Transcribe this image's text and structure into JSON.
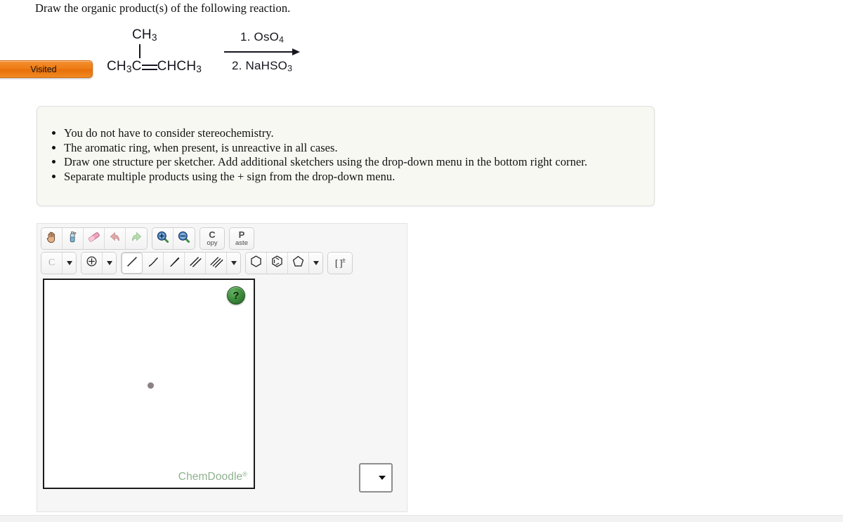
{
  "prompt": {
    "text": "Draw the organic product(s) of the following reaction."
  },
  "badge": {
    "label": "Visited",
    "color": "#ef7d16"
  },
  "reaction": {
    "substrate_branch": "CH3",
    "substrate_left": "CH3C",
    "substrate_right": "CHCH3",
    "substrate_formula": "CH3C=CHCH3 with CH3 branch (2-methyl-2-butene)",
    "reagent_top": "1. OsO4",
    "reagent_bottom": "2. NaHSO3",
    "arrow": "right-arrow"
  },
  "instructions": {
    "items": [
      "You do not have to consider stereochemistry.",
      "The aromatic ring, when present, is unreactive in all cases.",
      "Draw one structure per sketcher. Add additional sketchers using the drop-down menu in the bottom right corner.",
      "Separate multiple products using the + sign from the drop-down menu."
    ]
  },
  "sketcher": {
    "toolbar_row1": [
      {
        "name": "pan-hand-tool",
        "icon": "hand-icon",
        "label": ""
      },
      {
        "name": "clear-tool",
        "icon": "spray-bottle-icon",
        "label": ""
      },
      {
        "name": "eraser-tool",
        "icon": "eraser-icon",
        "label": ""
      },
      {
        "name": "undo-button",
        "icon": "undo-arrow-icon",
        "label": ""
      },
      {
        "name": "redo-button",
        "icon": "redo-arrow-icon",
        "label": ""
      },
      {
        "name": "zoom-in-button",
        "icon": "magnifier-plus-icon",
        "label": ""
      },
      {
        "name": "zoom-out-button",
        "icon": "magnifier-minus-icon",
        "label": ""
      },
      {
        "name": "copy-button",
        "icon": "copy-icon",
        "label_big": "C",
        "label_small": "opy"
      },
      {
        "name": "paste-button",
        "icon": "paste-icon",
        "label_big": "P",
        "label_small": "aste"
      }
    ],
    "toolbar_row2": {
      "atom_label": "C",
      "atom_dropdown": "chevron-down-icon",
      "charge_tool": "plus-circle-icon",
      "charge_dropdown": "chevron-down-icon",
      "bond_tools": [
        {
          "name": "single-bond-tool",
          "icon": "single-bond-icon",
          "selected": true
        },
        {
          "name": "hashed-wedge-bond-tool",
          "icon": "hashed-wedge-icon",
          "selected": false
        },
        {
          "name": "solid-wedge-bond-tool",
          "icon": "solid-wedge-icon",
          "selected": false
        },
        {
          "name": "double-bond-tool",
          "icon": "double-bond-icon",
          "selected": false
        },
        {
          "name": "triple-bond-tool",
          "icon": "triple-bond-icon",
          "selected": false
        }
      ],
      "bond_dropdown": "chevron-down-icon",
      "ring_tools": [
        {
          "name": "cyclohexane-ring-tool",
          "icon": "hexagon-icon"
        },
        {
          "name": "benzene-ring-tool",
          "icon": "benzene-icon"
        },
        {
          "name": "cyclopentane-ring-tool",
          "icon": "pentagon-icon"
        }
      ],
      "ring_dropdown": "chevron-down-icon",
      "bracket_tool_label": "[ ]",
      "bracket_tool_sup": "±"
    },
    "canvas": {
      "help_label": "?",
      "watermark": "ChemDoodle",
      "watermark_sup": "®",
      "watermark_color": "#8fb08f",
      "content": ""
    },
    "add_select": {
      "value": "",
      "icon": "chevron-down-icon"
    }
  }
}
